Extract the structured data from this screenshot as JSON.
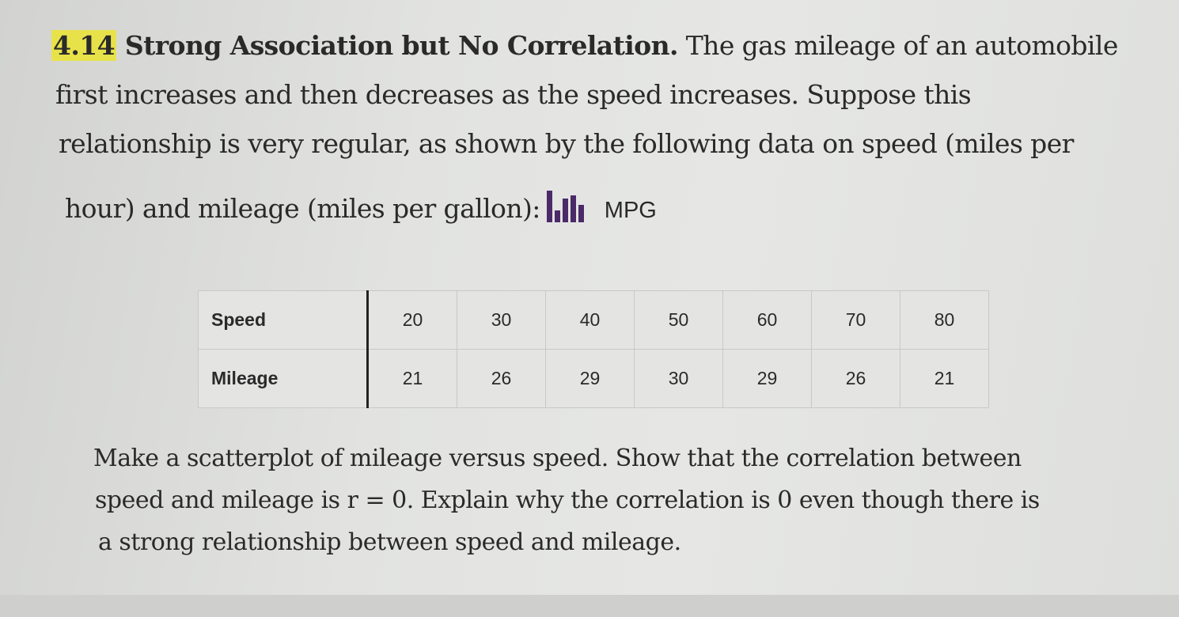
{
  "problem": {
    "number": "4.14",
    "title": "Strong Association but No Correlation.",
    "intro_lines": [
      "The gas mileage of an automobile",
      "first increases and then decreases as the speed increases. Suppose this",
      "relationship is very regular, as shown by the following data on speed (miles per",
      "hour) and mileage (miles per gallon):"
    ],
    "dataset_icon": "bar-chart-icon",
    "dataset_label": "MPG",
    "icon_color": "#4b2a68",
    "highlight_color": "#e8e24a"
  },
  "table": {
    "rows": [
      {
        "label": "Speed",
        "values": [
          "20",
          "30",
          "40",
          "50",
          "60",
          "70",
          "80"
        ]
      },
      {
        "label": "Mileage",
        "values": [
          "21",
          "26",
          "29",
          "30",
          "29",
          "26",
          "21"
        ]
      }
    ]
  },
  "question_lines": [
    "Make a scatterplot of mileage versus speed. Show that the correlation between",
    "speed and mileage is r = 0. Explain why the correlation is 0 even though there is",
    "a strong relationship between speed and mileage."
  ]
}
